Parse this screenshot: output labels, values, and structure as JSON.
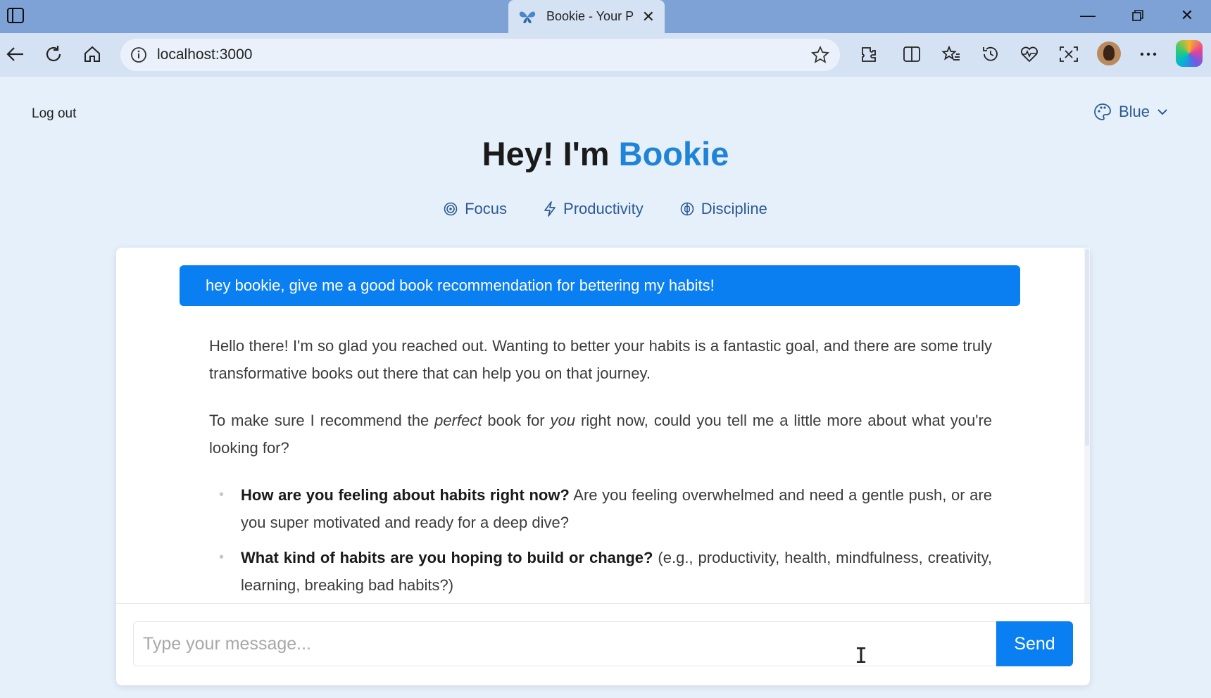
{
  "browser": {
    "tab_title": "Bookie - Your P",
    "url": "localhost:3000",
    "icons": [
      "tab-actions-icon",
      "back-icon",
      "refresh-icon",
      "home-icon",
      "site-info-icon",
      "favorite-star-icon",
      "extensions-icon",
      "split-screen-icon",
      "favorites-icon",
      "history-icon",
      "browser-essentials-icon",
      "screenshot-icon",
      "more-icon",
      "copilot-icon"
    ]
  },
  "page": {
    "logout_label": "Log out",
    "theme_label": "Blue",
    "headline_prefix": "Hey! I'm ",
    "headline_brand": "Bookie",
    "chips": [
      {
        "label": "Focus",
        "icon": "target-icon"
      },
      {
        "label": "Productivity",
        "icon": "lightning-icon"
      },
      {
        "label": "Discipline",
        "icon": "brain-icon"
      }
    ],
    "accent_color": "#0a7ff2"
  },
  "chat": {
    "user_message": "hey bookie, give me a good book recommendation for bettering my habits!",
    "bot_p1": "Hello there! I'm so glad you reached out. Wanting to better your habits is a fantastic goal, and there are some truly transformative books out there that can help you on that journey.",
    "bot_p2_a": "To make sure I recommend the ",
    "bot_p2_em1": "perfect",
    "bot_p2_b": " book for ",
    "bot_p2_em2": "you",
    "bot_p2_c": " right now, could you tell me a little more about what you're looking for?",
    "bullets": [
      {
        "bold": "How are you feeling about habits right now?",
        "text": " Are you feeling overwhelmed and need a gentle push, or are you super motivated and ready for a deep dive?"
      },
      {
        "bold": "What kind of habits are you hoping to build or change?",
        "text": " (e.g., productivity, health, mindfulness, creativity, learning, breaking bad habits?)"
      }
    ],
    "input_placeholder": "Type your message...",
    "send_label": "Send"
  }
}
